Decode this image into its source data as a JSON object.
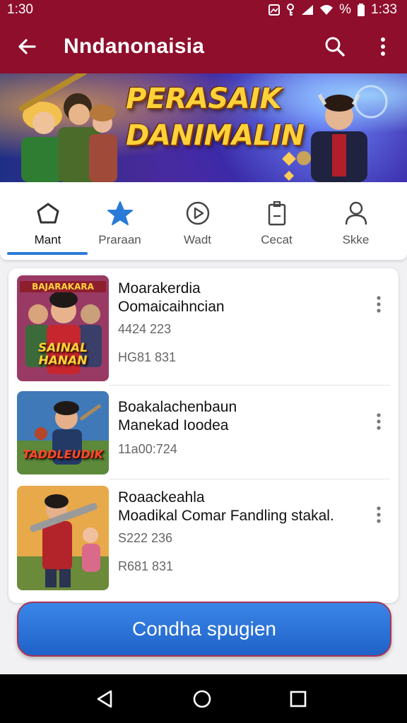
{
  "status_bar": {
    "time_left": "1:30",
    "battery": "%",
    "time_right": "1:33"
  },
  "app_bar": {
    "title": "Nndanonaisia",
    "back_icon": "arrow-back-icon",
    "search_icon": "search-icon",
    "more_icon": "more-vert-icon",
    "color": "#8e0e2c"
  },
  "banner": {
    "headline_line1": "PERASAIK",
    "headline_line2": "DANIMALIN"
  },
  "tabs": [
    {
      "label": "Mant",
      "icon": "home-icon",
      "active": true
    },
    {
      "label": "Praraan",
      "icon": "star-icon",
      "active": false
    },
    {
      "label": "Wadt",
      "icon": "play-circle-icon",
      "active": false
    },
    {
      "label": "Cecat",
      "icon": "document-icon",
      "active": false
    },
    {
      "label": "Skke",
      "icon": "person-icon",
      "active": false
    }
  ],
  "list": [
    {
      "thumb_title": "SAINAL HANAN",
      "thumb_top": "BAJARAKARA",
      "title_line1": "Moarakerdia",
      "title_line2": "Oomaicaihncian",
      "meta1": "4424 223",
      "meta2": "HG81 831"
    },
    {
      "thumb_title": "TADDLEUDIK",
      "title_line1": "Boakalachenbaun",
      "title_line2": "Manekad Ioodea",
      "meta1": "11a00:724"
    },
    {
      "thumb_title": "",
      "title_line1": "Roaackeahla",
      "title_line2": "Moadikal Comar Fandling stakal.",
      "meta1": "S222 236",
      "meta2": "R681 831"
    }
  ],
  "cta": {
    "label": "Condha spugien",
    "color": "#1f62c8"
  },
  "nav_bar": {
    "back": "nav-back-icon",
    "home": "nav-home-icon",
    "recents": "nav-recents-icon"
  }
}
